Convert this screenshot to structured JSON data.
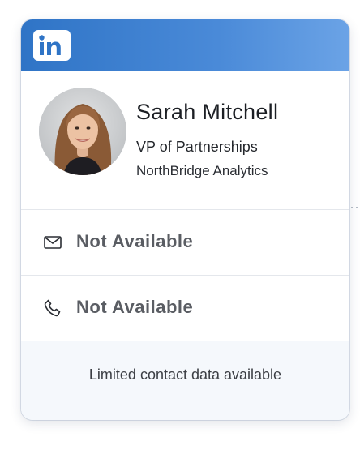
{
  "header": {
    "brand": "LinkedIn",
    "logo_text": "in",
    "gradient_colors": [
      "#2f74c6",
      "#6ba3e6"
    ],
    "logo_icon": "linkedin-logo-icon"
  },
  "profile": {
    "name": "Sarah Mitchell",
    "title": "VP of Partnerships",
    "company": "NorthBridge Analytics",
    "avatar_icon": "profile-photo"
  },
  "contact": {
    "email": {
      "icon": "envelope-icon",
      "value": "Not Available"
    },
    "phone": {
      "icon": "phone-icon",
      "value": "Not Available"
    }
  },
  "footer": {
    "note": "Limited contact data available"
  },
  "colors": {
    "accent": "#3a7fcf",
    "unavailable_text": "#5a5d63",
    "footer_bg": "#f5f8fc"
  }
}
